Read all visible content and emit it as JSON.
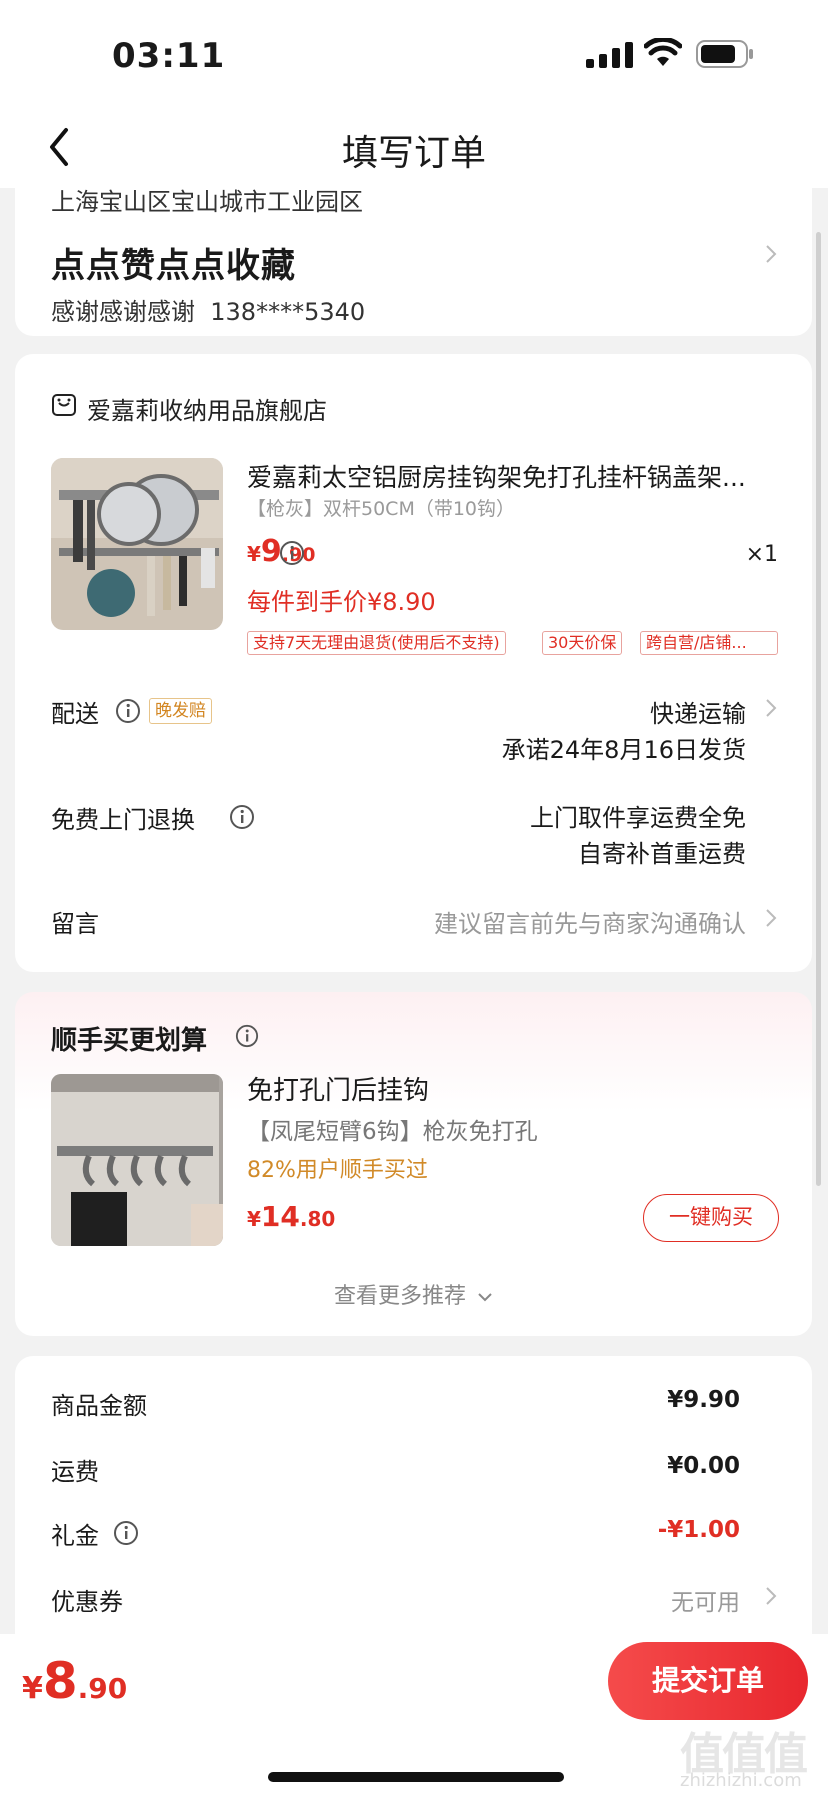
{
  "status_bar": {
    "time": "03:11"
  },
  "nav": {
    "title": "填写订单"
  },
  "address": {
    "region": "上海宝山区宝山城市工业园区",
    "detail": "点点赞点点收藏",
    "name": "感谢感谢感谢",
    "phone": "138****5340"
  },
  "order": {
    "store_name": "爱嘉莉收纳用品旗舰店",
    "product": {
      "title": "爱嘉莉太空铝厨房挂钩架免打孔挂杆锅盖架...",
      "spec": "【枪灰】双杆50CM（带10钩）",
      "price_currency": "¥",
      "price_int": "9",
      "price_dec": ".90",
      "quantity": "×1",
      "each_price": "每件到手价¥8.90",
      "tags": [
        "支持7天无理由退货(使用后不支持)",
        "30天价保",
        "跨自营/店铺..."
      ]
    },
    "delivery": {
      "label": "配送",
      "badge": "晚发赔",
      "method": "快递运输",
      "promise": "承诺24年8月16日发货"
    },
    "return": {
      "label": "免费上门退换",
      "line1": "上门取件享运费全免",
      "line2": "自寄补首重运费"
    },
    "message": {
      "label": "留言",
      "placeholder": "建议留言前先与商家沟通确认"
    }
  },
  "recommend": {
    "title": "顺手买更划算",
    "name": "免打孔门后挂钩",
    "spec": "【凤尾短臂6钩】枪灰免打孔",
    "bought": "82%用户顺手买过",
    "price_currency": "¥",
    "price_int": "14",
    "price_dec": ".80",
    "buy_label": "一键购买",
    "more_label": "查看更多推荐"
  },
  "summary": {
    "goods_label": "商品金额",
    "goods_value": "¥9.90",
    "shipping_label": "运费",
    "shipping_value": "¥0.00",
    "gift_label": "礼金",
    "gift_value": "-¥1.00",
    "coupon_label": "优惠券",
    "coupon_value": "无可用"
  },
  "footer": {
    "total_currency": "¥",
    "total_int": "8",
    "total_dec": ".90",
    "submit_label": "提交订单"
  },
  "watermark": {
    "main": "值值值",
    "sub": "zhizhizhi.com"
  },
  "colors": {
    "accent": "#e02e24",
    "orange": "#d28520",
    "background": "#f2f2f2"
  }
}
